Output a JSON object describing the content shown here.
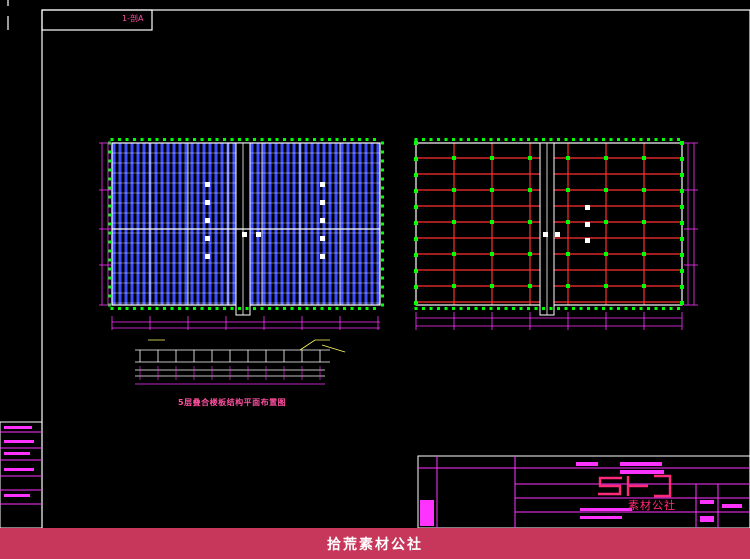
{
  "drawing": {
    "sheet_tag": "1-剖A",
    "caption": "5层叠合楼板结构平面布置图"
  },
  "watermark": {
    "text": "素材公社"
  },
  "footer": {
    "banner_text": "拾荒素材公社"
  },
  "colors": {
    "background": "#000000",
    "frame": "#ffffff",
    "magenta": "#ff33ff",
    "blue_grid": "#3b4bff",
    "red_grid": "#ff3030",
    "green_nodes": "#00ff00",
    "banner": "#c7375b"
  }
}
